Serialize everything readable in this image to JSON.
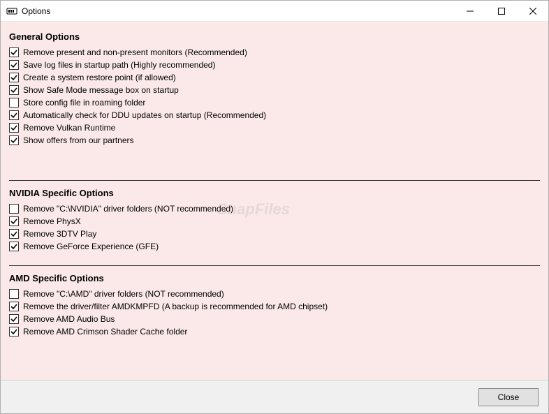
{
  "window": {
    "title": "Options"
  },
  "sections": {
    "general": {
      "title": "General Options",
      "options": [
        {
          "label": "Remove present and non-present monitors (Recommended)",
          "checked": true
        },
        {
          "label": "Save log files in startup path (Highly recommended)",
          "checked": true
        },
        {
          "label": "Create a system restore point (if allowed)",
          "checked": true
        },
        {
          "label": "Show Safe Mode message box on startup",
          "checked": true
        },
        {
          "label": "Store config file in roaming folder",
          "checked": false
        },
        {
          "label": "Automatically check for DDU updates on startup (Recommended)",
          "checked": true
        },
        {
          "label": "Remove Vulkan Runtime",
          "checked": true
        },
        {
          "label": "Show offers from our partners",
          "checked": true
        }
      ]
    },
    "nvidia": {
      "title": "NVIDIA Specific Options",
      "options": [
        {
          "label": "Remove \"C:\\NVIDIA\" driver folders (NOT recommended)",
          "checked": false
        },
        {
          "label": "Remove PhysX",
          "checked": true
        },
        {
          "label": "Remove 3DTV Play",
          "checked": true
        },
        {
          "label": "Remove GeForce Experience (GFE)",
          "checked": true
        }
      ]
    },
    "amd": {
      "title": "AMD Specific Options",
      "options": [
        {
          "label": "Remove \"C:\\AMD\" driver folders (NOT recommended)",
          "checked": false
        },
        {
          "label": "Remove the driver/filter AMDKMPFD (A backup is recommended for AMD chipset)",
          "checked": true
        },
        {
          "label": "Remove AMD Audio Bus",
          "checked": true
        },
        {
          "label": "Remove AMD Crimson Shader Cache folder",
          "checked": true
        }
      ]
    }
  },
  "footer": {
    "close_label": "Close"
  },
  "watermark": "SnapFiles"
}
